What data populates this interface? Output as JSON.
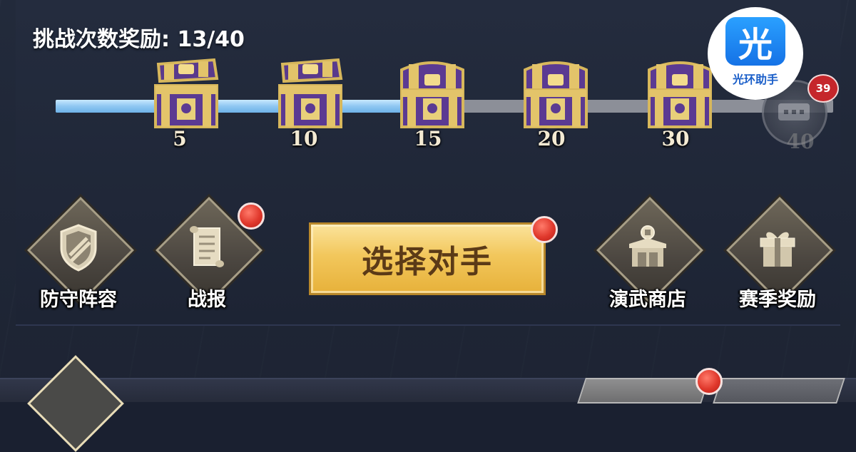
{
  "challenge_rewards": {
    "label": "挑战次数奖励: 13/40",
    "current": 13,
    "total": 40,
    "progress_fraction": 0.475,
    "milestones": [
      {
        "value": "5",
        "state": "opened"
      },
      {
        "value": "10",
        "state": "opened"
      },
      {
        "value": "15",
        "state": "locked"
      },
      {
        "value": "20",
        "state": "locked"
      },
      {
        "value": "30",
        "state": "locked"
      }
    ],
    "final_milestone": {
      "value": "40",
      "state": "obscured"
    }
  },
  "overlay": {
    "badge_count": "39",
    "watermark_glyph": "光",
    "watermark_text": "光环助手"
  },
  "actions": {
    "defense": {
      "label": "防守阵容",
      "icon": "shield-icon",
      "notification": false
    },
    "battle_report": {
      "label": "战报",
      "icon": "scroll-icon",
      "notification": true
    },
    "select_opponent": {
      "label": "选择对手",
      "notification": true
    },
    "shop": {
      "label": "演武商店",
      "icon": "shop-icon",
      "notification": false
    },
    "season_rewards": {
      "label": "赛季奖励",
      "icon": "gift-icon",
      "notification": false
    }
  },
  "colors": {
    "progress_fill": "#8fc7f2",
    "progress_track": "#8c8f98",
    "button_gold": "#f2c75c",
    "notification_red": "#e0382c"
  }
}
